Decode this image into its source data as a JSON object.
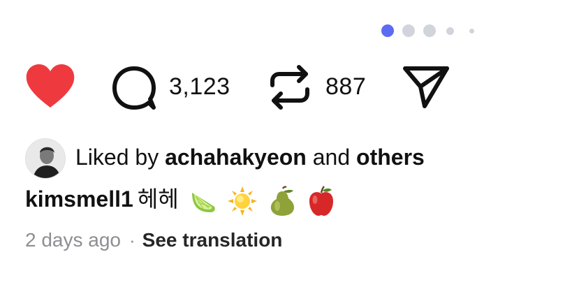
{
  "pagination": {
    "total": 5,
    "active_index": 0,
    "active_color": "#5b6cf0",
    "inactive_color": "#d1d5db"
  },
  "actions": {
    "like": {
      "icon": "heart-icon",
      "liked": true,
      "color": "#ee3a3f"
    },
    "comment": {
      "icon": "comment-icon",
      "count": "3,123"
    },
    "repost": {
      "icon": "repost-icon",
      "count": "887"
    },
    "share": {
      "icon": "send-icon"
    }
  },
  "likes": {
    "prefix": "Liked by",
    "user": "achahakyeon",
    "joiner": "and",
    "others": "others"
  },
  "caption": {
    "username": "kimsmell1",
    "text": "헤헤",
    "emojis": [
      "lime-emoji",
      "sun-emoji",
      "pear-emoji",
      "apple-emoji"
    ]
  },
  "meta": {
    "time": "2 days ago",
    "separator": "·",
    "translate": "See translation"
  }
}
